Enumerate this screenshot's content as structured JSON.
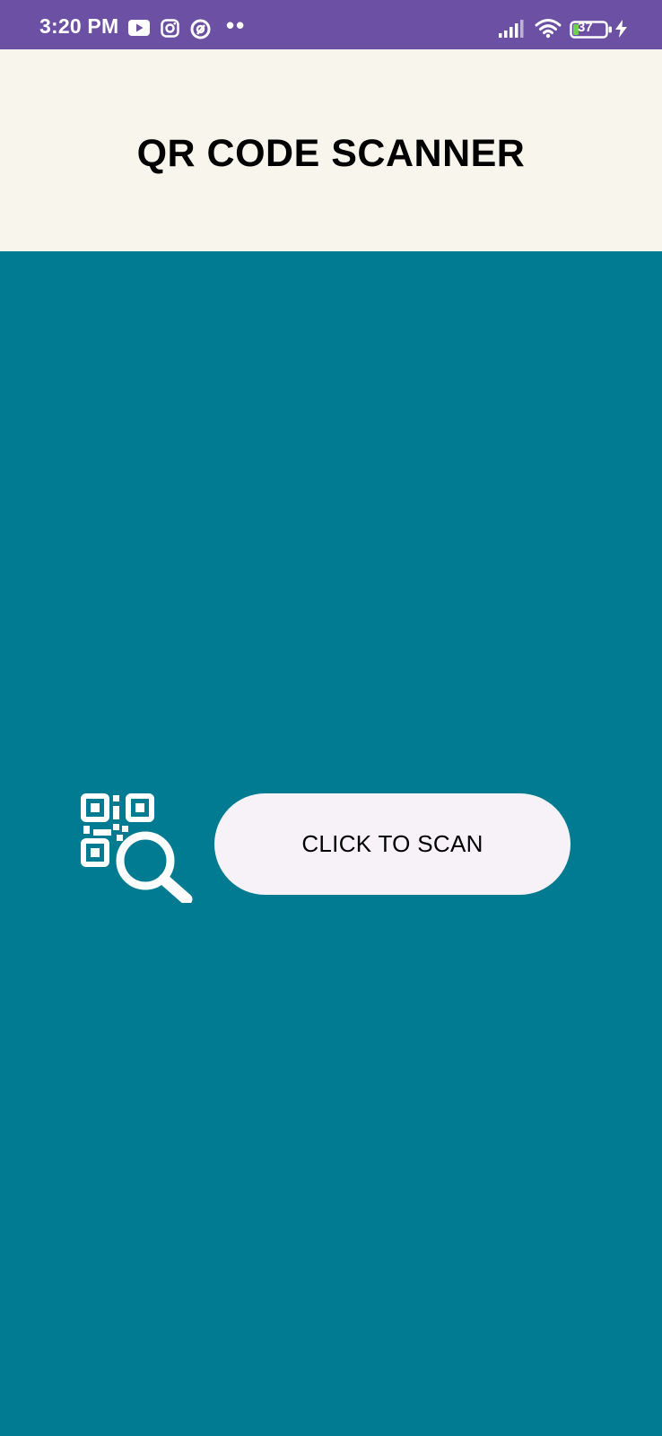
{
  "status_bar": {
    "time": "3:20 PM",
    "notification_icons": [
      "youtube-icon",
      "instagram-icon",
      "app-notification-icon"
    ],
    "more_indicator": "••",
    "battery_level": "37",
    "background_color": "#6B50A3"
  },
  "header": {
    "title": "QR CODE SCANNER",
    "background_color": "#F8F5EC"
  },
  "main": {
    "background_color": "#017B92",
    "scan_button_label": "CLICK TO SCAN",
    "scan_icon": "qr-search-icon"
  }
}
